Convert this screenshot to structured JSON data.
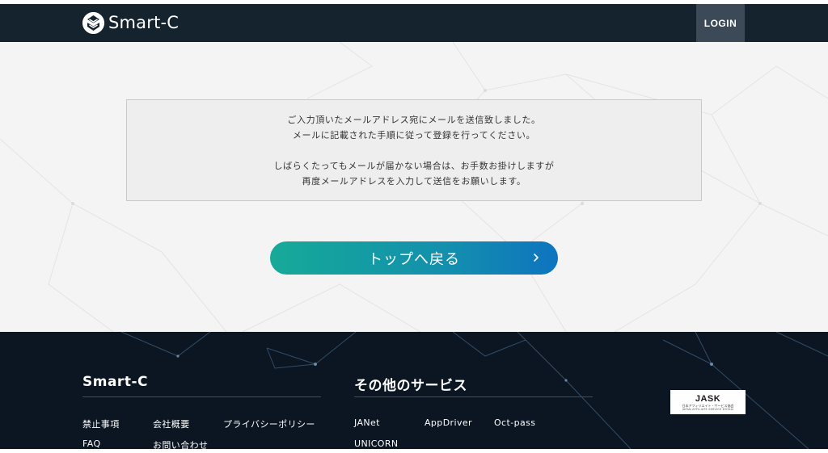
{
  "header": {
    "logo_text": "Smart-C",
    "login_label": "LOGIN"
  },
  "main": {
    "message_paragraphs": [
      [
        "ご入力頂いたメールアドレス宛にメールを送信致しました。",
        "メールに記載された手順に従って登録を行ってください。"
      ],
      [
        "しばらくたってもメールが届かない場合は、お手数お掛けしますが",
        "再度メールアドレスを入力して送信をお願いします。"
      ]
    ],
    "back_button_label": "トップへ戻る"
  },
  "footer": {
    "smartc": {
      "heading": "Smart-C",
      "links": [
        "禁止事項",
        "会社概要",
        "プライバシーポリシー",
        "FAQ",
        "お問い合わせ"
      ]
    },
    "services": {
      "heading": "その他のサービス",
      "links": [
        "JANet",
        "AppDriver",
        "Oct-pass",
        "UNICORN"
      ]
    },
    "badge": {
      "title": "JASK",
      "subtitle": "日本アフィリエイト・サービス協会",
      "subtitle_en": "JAPAN AFFILIATE SERVICE KYOKAI"
    }
  },
  "colors": {
    "header_bg": "#15232f",
    "login_bg": "#3b4a56",
    "main_bg": "#f4f4f4",
    "footer_bg": "#0b1622",
    "button_gradient_start": "#16aa98",
    "button_gradient_end": "#0e74bf"
  },
  "icons": {
    "logo": "smart-c-logo-icon",
    "chevron": "chevron-right-icon"
  }
}
